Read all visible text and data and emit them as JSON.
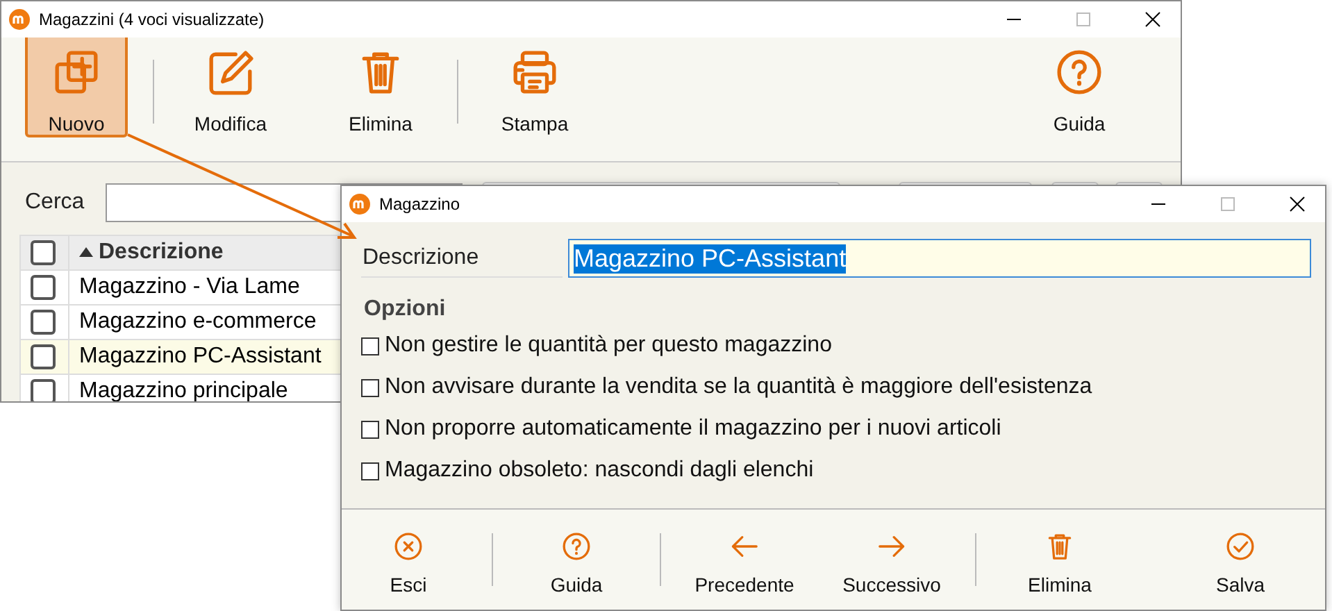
{
  "main_window": {
    "title": "Magazzini (4 voci visualizzate)",
    "toolbar": {
      "groups": [
        [
          {
            "label": "Nuovo",
            "kind": "new",
            "selected": true
          }
        ],
        [
          {
            "label": "Modifica",
            "kind": "edit",
            "selected": false
          },
          {
            "label": "Elimina",
            "kind": "delete",
            "selected": false
          }
        ],
        [
          {
            "label": "Stampa",
            "kind": "print",
            "selected": false
          }
        ]
      ],
      "right": [
        {
          "label": "Guida",
          "kind": "help",
          "selected": false
        }
      ]
    },
    "search": {
      "label": "Cerca"
    },
    "table": {
      "all_checked": false,
      "columns": [
        {
          "label": "Descrizione",
          "sorted": true
        }
      ],
      "rows": [
        {
          "description": "Magazzino - Via Lame",
          "checked": false,
          "selected": false
        },
        {
          "description": "Magazzino e-commerce",
          "checked": false,
          "selected": false
        },
        {
          "description": "Magazzino PC-Assistant",
          "checked": false,
          "selected": true
        },
        {
          "description": "Magazzino principale",
          "checked": false,
          "selected": false
        }
      ]
    }
  },
  "dialog": {
    "title": "Magazzino",
    "description": {
      "label": "Descrizione",
      "value": "Magazzino PC-Assistant",
      "value_selected": true
    },
    "options_title": "Opzioni",
    "options": [
      {
        "label": "Non gestire le quantità per questo magazzino",
        "checked": false
      },
      {
        "label": "Non avvisare durante la vendita se la quantità è maggiore dell'esistenza",
        "checked": false
      },
      {
        "label": "Non proporre automaticamente il magazzino per i nuovi articoli",
        "checked": false
      },
      {
        "label": "Magazzino obsoleto: nascondi dagli elenchi",
        "checked": false
      }
    ],
    "footer": {
      "groups": [
        [
          {
            "label": "Esci",
            "kind": "cancel"
          }
        ],
        [
          {
            "label": "Guida",
            "kind": "help"
          }
        ],
        [
          {
            "label": "Precedente",
            "kind": "prev"
          },
          {
            "label": "Successivo",
            "kind": "next"
          }
        ],
        [
          {
            "label": "Elimina",
            "kind": "delete"
          }
        ]
      ],
      "right": [
        {
          "label": "Salva",
          "kind": "save"
        }
      ]
    }
  }
}
